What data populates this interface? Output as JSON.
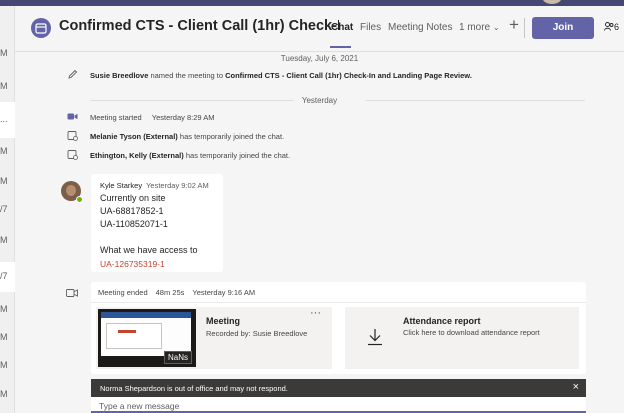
{
  "left_rail": {
    "marks": [
      "M",
      "M",
      "...",
      "M",
      "M",
      "/7",
      "M",
      "/7",
      "M",
      "M",
      "M",
      "M"
    ]
  },
  "header": {
    "title": "Confirmed CTS - Client Call (1hr) Check-In an...",
    "tabs": [
      {
        "label": "Chat",
        "active": true
      },
      {
        "label": "Files",
        "active": false
      },
      {
        "label": "Meeting Notes",
        "active": false
      },
      {
        "label": "1 more",
        "active": false
      }
    ],
    "add_tab": "+",
    "join_label": "Join",
    "participants_count": "6"
  },
  "conversation": {
    "date_sep_1": "Tuesday, July 6, 2021",
    "rename_event": {
      "actor": "Susie Breedlove",
      "text": "named the meeting to",
      "meeting_name": "Confirmed CTS - Client Call (1hr) Check-In and Landing Page Review."
    },
    "date_sep_2": "Yesterday",
    "meeting_started": {
      "text": "Meeting started",
      "time": "Yesterday 8:29 AM"
    },
    "joined_1": {
      "name": "Melanie Tyson (External)",
      "text": "has temporarily joined the chat."
    },
    "joined_2": {
      "name": "Ethington, Kelly (External)",
      "text": "has temporarily joined the chat."
    },
    "message": {
      "author": "Kyle Starkey",
      "time": "Yesterday 9:02 AM",
      "lines": [
        "Currently on site",
        "UA-68817852-1",
        "UA-110852071-1",
        "",
        "What we have access to"
      ],
      "link": "UA-126735319-1"
    },
    "recap": {
      "ended": "Meeting ended",
      "duration": "48m 25s",
      "time": "Yesterday 9:16 AM",
      "recording_title": "Meeting",
      "recorded_by": "Recorded by: Susie Breedlove",
      "thumb_badge": "NaNs",
      "more": "···",
      "attendance_title": "Attendance report",
      "attendance_sub": "Click here to download attendance report"
    }
  },
  "banner": {
    "text": "Norma Shepardson is out of office and may not respond.",
    "close": "×"
  },
  "compose": {
    "placeholder": "Type a new message"
  },
  "colors": {
    "brand": "#6264a7",
    "link": "#c4452f",
    "banner_bg": "#3b3a39"
  }
}
